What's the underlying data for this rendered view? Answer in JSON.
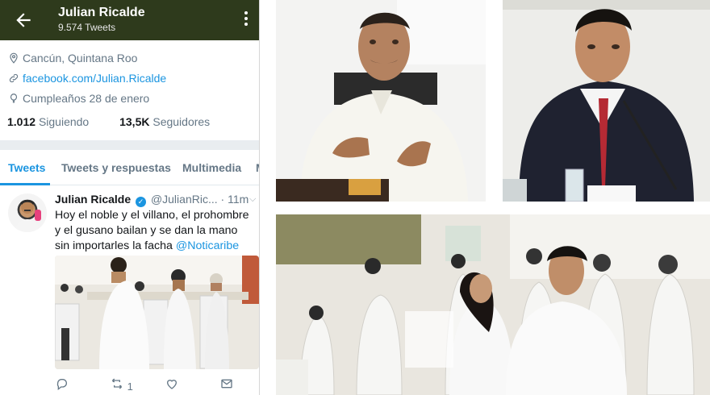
{
  "header": {
    "name": "Julian Ricalde",
    "tweets_count": "9.574 Tweets"
  },
  "profile": {
    "location": "Cancún, Quintana Roo",
    "website": "facebook.com/Julian.Ricalde",
    "birthday": "Cumpleaños 28 de enero",
    "following_value": "1.012",
    "following_label": "Siguiendo",
    "followers_value": "13,5K",
    "followers_label": "Seguidores"
  },
  "tabs": [
    "Tweets",
    "Tweets y respuestas",
    "Multimedia",
    "M"
  ],
  "tweet": {
    "author": "Julian Ricalde",
    "handle": "@JulianRic...",
    "time": "· 11m",
    "text": "Hoy el noble y el villano, el prohombre y el gusano bailan y se dan la mano sin importarles la facha",
    "mention": "@Noticaribe",
    "retweets": "1"
  },
  "colors": {
    "header_bg": "#2e3a1c",
    "accent": "#1b95e0",
    "muted": "#657786"
  },
  "icons": [
    "back-arrow-icon",
    "more-vertical-icon",
    "location-icon",
    "link-icon",
    "birthday-icon",
    "verified-icon",
    "chevron-down-icon",
    "reply-icon",
    "retweet-icon",
    "like-icon",
    "message-icon"
  ]
}
